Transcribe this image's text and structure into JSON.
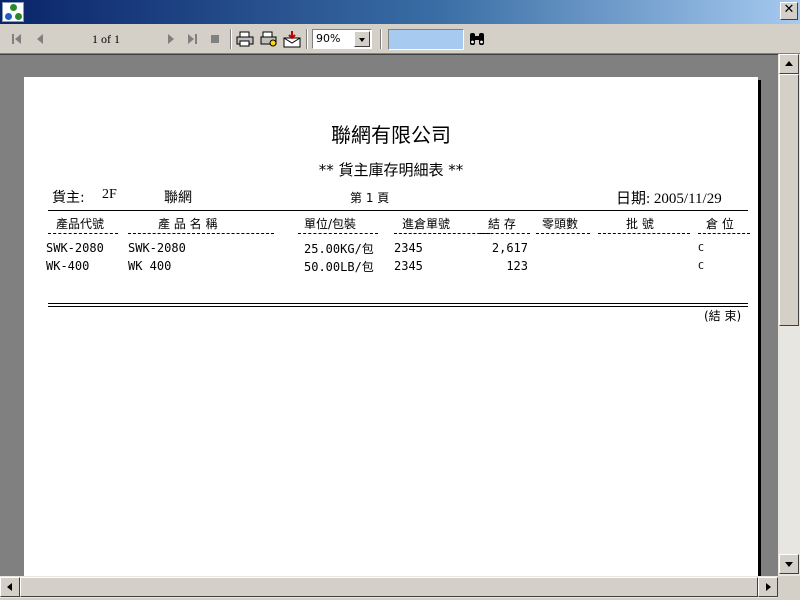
{
  "toolbar": {
    "page_indicator": "1 of 1",
    "zoom_value": "90%",
    "search_value": ""
  },
  "report": {
    "company": "聯網有限公司",
    "subtitle": "** 貨主庫存明細表 **",
    "owner_label": "貨主:",
    "owner_code": "2F",
    "owner_name": "聯網",
    "page_label": "第 1 頁",
    "date_label": "日期: 2005/11/29",
    "columns": [
      "產品代號",
      "產 品 名 稱",
      "單位/包裝",
      "進倉單號",
      "結 存",
      "零頭數",
      "批 號",
      "倉 位"
    ],
    "rows": [
      {
        "code": "SWK-2080",
        "name": "SWK-2080",
        "unit": "25.00KG/包",
        "receipt": "2345",
        "balance": "2,617",
        "remainder": "",
        "batch": "",
        "location": "C"
      },
      {
        "code": "WK-400",
        "name": "WK 400",
        "unit": "50.00LB/包",
        "receipt": "2345",
        "balance": "123",
        "remainder": "",
        "batch": "",
        "location": "C"
      }
    ],
    "end_marker": "(結 束)"
  }
}
